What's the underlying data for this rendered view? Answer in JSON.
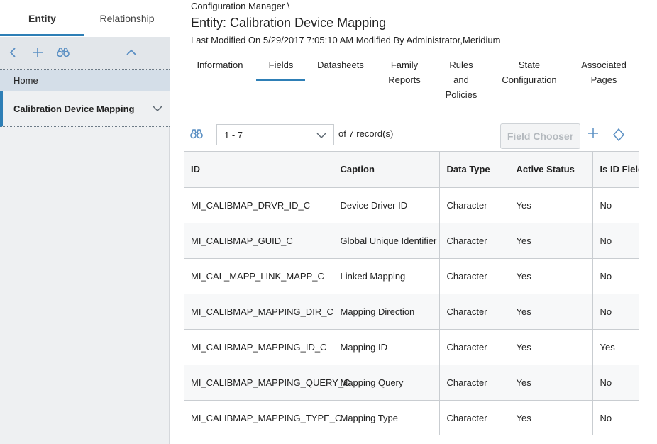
{
  "left_panel": {
    "tabs": [
      "Entity",
      "Relationship"
    ],
    "home_label": "Home",
    "selected_item": "Calibration Device Mapping"
  },
  "header": {
    "breadcrumb": "Configuration Manager \\",
    "title": "Entity: Calibration Device Mapping",
    "modified": "Last Modified On 5/29/2017 7:05:10 AM Modified By Administrator,Meridium"
  },
  "tabs": [
    {
      "label": "Information"
    },
    {
      "label": "Fields"
    },
    {
      "label": "Datasheets"
    },
    {
      "label": "Family\nReports"
    },
    {
      "label": "Rules\nand\nPolicies"
    },
    {
      "label": "State\nConfiguration"
    },
    {
      "label": "Associated\nPages"
    }
  ],
  "active_tab": "Fields",
  "records": {
    "range": "1 - 7",
    "total_text": "of 7  record(s)",
    "field_chooser_label": "Field Chooser"
  },
  "table": {
    "headers": [
      "ID",
      "Caption",
      "Data Type",
      "Active Status",
      "Is ID Field"
    ],
    "rows": [
      [
        "MI_CALIBMAP_DRVR_ID_C",
        "Device Driver ID",
        "Character",
        "Yes",
        "No"
      ],
      [
        "MI_CALIBMAP_GUID_C",
        "Global Unique Identifier",
        "Character",
        "Yes",
        "No"
      ],
      [
        "MI_CAL_MAPP_LINK_MAPP_C",
        "Linked Mapping",
        "Character",
        "Yes",
        "No"
      ],
      [
        "MI_CALIBMAP_MAPPING_DIR_C",
        "Mapping Direction",
        "Character",
        "Yes",
        "No"
      ],
      [
        "MI_CALIBMAP_MAPPING_ID_C",
        "Mapping ID",
        "Character",
        "Yes",
        "Yes"
      ],
      [
        "MI_CALIBMAP_MAPPING_QUERY_C",
        "Mapping Query",
        "Character",
        "Yes",
        "No"
      ],
      [
        "MI_CALIBMAP_MAPPING_TYPE_C",
        "Mapping Type",
        "Character",
        "Yes",
        "No"
      ]
    ]
  },
  "colors": {
    "accent": "#2e7fb6",
    "icon": "#5a8fc3",
    "panel_bg": "#eef0f2",
    "home_bg": "#d4dee8"
  },
  "icons": {
    "toolbar": [
      "back-icon",
      "add-icon",
      "binoculars-icon",
      "collapse-up-icon"
    ]
  }
}
